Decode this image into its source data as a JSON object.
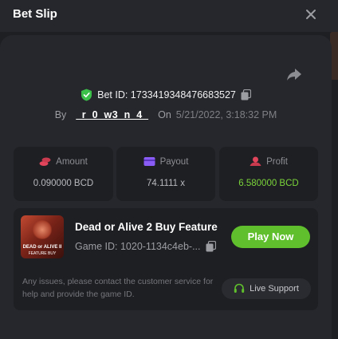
{
  "header": {
    "title": "Bet Slip"
  },
  "bet": {
    "id_label": "Bet ID: 1733419348476683527",
    "by_label": "By",
    "username": "_r_0_w3_n_4_",
    "on_label": "On",
    "date": "5/21/2022, 3:18:32 PM"
  },
  "stats": {
    "amount": {
      "label": "Amount",
      "value": "0.090000 BCD"
    },
    "payout": {
      "label": "Payout",
      "value": "74.1111 x"
    },
    "profit": {
      "label": "Profit",
      "value": "6.580000 BCD"
    }
  },
  "game": {
    "name": "Dead or Alive 2 Buy Feature",
    "id_text": "Game ID: 1020-1134c4eb-...",
    "thumb_line1": "DEAD or ALIVE II",
    "thumb_line2": "FEATURE BUY",
    "play_label": "Play Now",
    "notice": "Any issues, please contact the customer service for help and provide the game ID.",
    "support_label": "Live Support"
  },
  "colors": {
    "accent_green": "#5fbf2c",
    "profit_green": "#7ad43a",
    "amount_icon": "#e0455b",
    "payout_icon": "#8a5cf6",
    "profit_icon": "#e0455b",
    "shield_green": "#3bc14a"
  },
  "icons": {
    "close": "close-icon",
    "share": "share-icon",
    "shield": "shield-check-icon",
    "copy": "copy-icon",
    "amount": "coins-icon",
    "payout": "wallet-icon",
    "profit": "profit-icon",
    "support": "headset-icon"
  }
}
